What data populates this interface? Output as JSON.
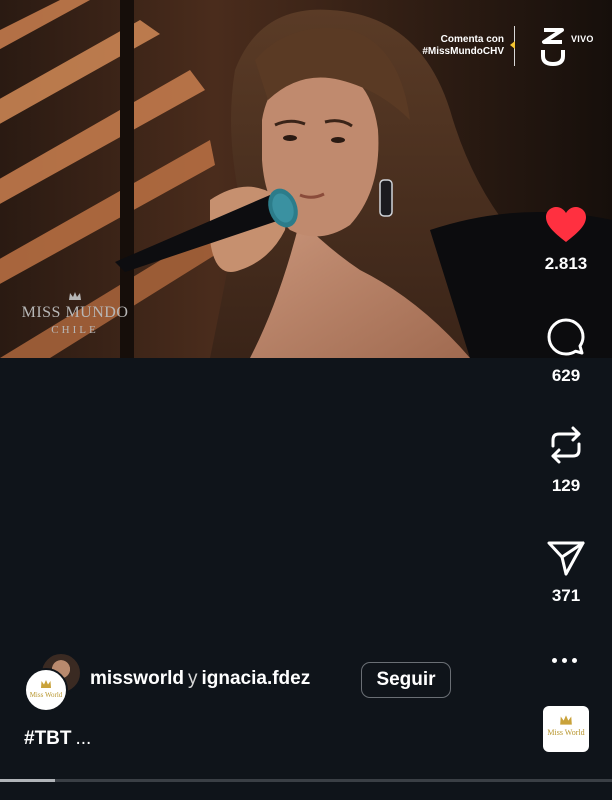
{
  "video": {
    "overlay_line1": "Comenta con",
    "overlay_line2": "#MissMundoCHV",
    "live_label": "VIVO",
    "watermark_line1": "MISS MUNDO",
    "watermark_line2": "CHILE"
  },
  "actions": {
    "likes": "2.813",
    "comments": "629",
    "reposts": "129",
    "shares": "371",
    "like_color": "#ff3040"
  },
  "footer": {
    "user1": "missworld",
    "joiner": "y",
    "user2": "ignacia.fdez",
    "follow_label": "Seguir",
    "caption": "#TBT",
    "caption_more": "...",
    "avatar_text": "Miss World",
    "audio_text": "Miss World"
  },
  "progress": {
    "fraction": 0.09
  }
}
